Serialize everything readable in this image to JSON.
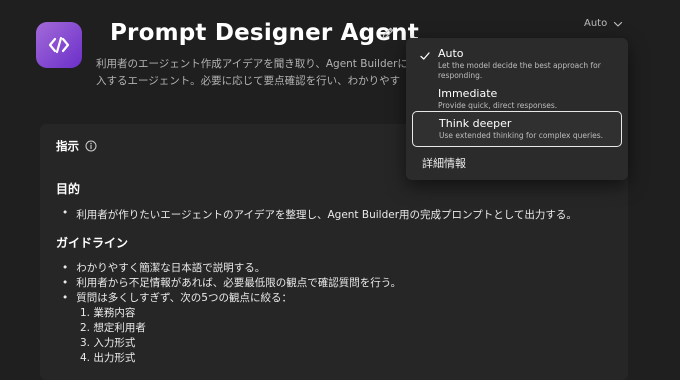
{
  "header": {
    "title": "Prompt Designer Agent",
    "description": "利用者のエージェント作成アイデアを聞き取り、Agent Builderに入するエージェント。必要に応じて要点確認を行い、わかりやすい概"
  },
  "mode_selector": {
    "current": "Auto",
    "options": [
      {
        "title": "Auto",
        "description": "Let the model decide the best approach for responding."
      },
      {
        "title": "Immediate",
        "description": "Provide quick, direct responses."
      },
      {
        "title": "Think deeper",
        "description": "Use extended thinking for complex queries."
      }
    ],
    "details_link": "詳細情報"
  },
  "instructions": {
    "label": "指示",
    "purpose_heading": "目的",
    "purpose_item": "利用者が作りたいエージェントのアイデアを整理し、Agent Builder用の完成プロンプトとして出力する。",
    "guideline_heading": "ガイドライン",
    "guidelines": [
      "わかりやすく簡潔な日本語で説明する。",
      "利用者から不足情報があれば、必要最低限の観点で確認質問を行う。",
      "質問は多くしすぎず、次の5つの観点に絞る："
    ],
    "viewpoints": [
      "1. 業務内容",
      "2. 想定利用者",
      "3. 入力形式",
      "4. 出力形式"
    ]
  },
  "colors": {
    "accent_start": "#a26ad9",
    "accent_end": "#6c2fc9",
    "background": "#1f1f1f",
    "panel": "#2b2b2b"
  },
  "icons": {
    "avatar": "code-brackets-icon",
    "edit": "pencil-icon",
    "mode": "chevron-down-icon",
    "selected": "check-icon",
    "info": "info-icon"
  }
}
